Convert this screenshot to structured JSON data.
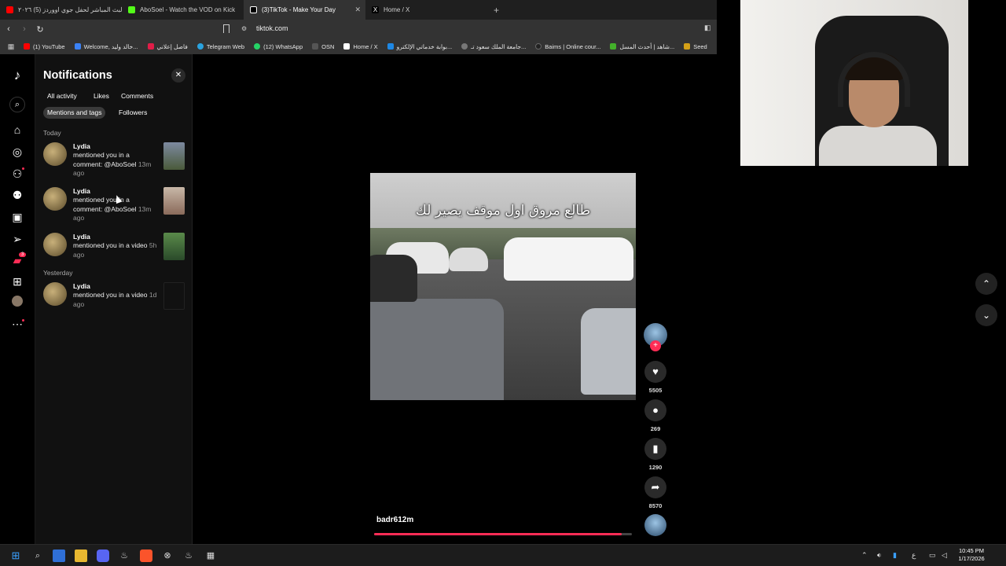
{
  "browser": {
    "tabs": [
      {
        "label": "البث المباشر لحفل جوي اووردز (5) ٢٠٢٦",
        "color": "#ff0000"
      },
      {
        "label": "AboSoel - Watch the VOD on Kick",
        "color": "#53fc18"
      },
      {
        "label": "(3)TikTok - Make Your Day",
        "color": "#ffffff"
      },
      {
        "label": "Home / X",
        "color": "#ffffff"
      }
    ],
    "url": "tiktok.com",
    "bookmarks": [
      {
        "label": "(1) YouTube",
        "color": "#ff0000"
      },
      {
        "label": "Welcome, خالد وليد...",
        "color": "#3b82f6"
      },
      {
        "label": "فاصل إعلاني",
        "color": "#e11d48"
      },
      {
        "label": "Telegram Web",
        "color": "#2aa3e0"
      },
      {
        "label": "(12) WhatsApp",
        "color": "#25d366"
      },
      {
        "label": "OSN",
        "color": "#333333"
      },
      {
        "label": "Home / X",
        "color": "#ffffff"
      },
      {
        "label": "بوابة خدماتي الإلكترو...",
        "color": "#1e88e5"
      },
      {
        "label": "جامعة الملك سعود تـ...",
        "color": "#777777"
      },
      {
        "label": "Baims | Online cour...",
        "color": "#222222"
      },
      {
        "label": "شاهد | أحدث المسل...",
        "color": "#43b02a"
      },
      {
        "label": "Seed",
        "color": "#d4a017"
      }
    ]
  },
  "sidebar": {
    "badges": {
      "inbox": "3"
    },
    "icons": [
      "tiktok-logo-icon",
      "search-icon",
      "home-icon",
      "explore-icon",
      "following-icon",
      "friends-icon",
      "live-icon",
      "messages-icon",
      "inbox-icon",
      "upload-icon",
      "profile-icon",
      "more-icon"
    ]
  },
  "notifications": {
    "title": "Notifications",
    "filters": [
      "All activity",
      "Likes",
      "Comments",
      "Mentions and tags",
      "Followers"
    ],
    "selected_filter": "Mentions and tags",
    "sections": [
      {
        "label": "Today",
        "items": [
          {
            "user": "Lydia",
            "text": "mentioned you in a comment: @AboSoel",
            "time": "13m ago"
          },
          {
            "user": "Lydia",
            "text": "mentioned you in a comment: @AboSoel",
            "time": "13m ago"
          },
          {
            "user": "Lydia",
            "text": "mentioned you in a video",
            "time": "5h ago"
          }
        ]
      },
      {
        "label": "Yesterday",
        "items": [
          {
            "user": "Lydia",
            "text": "mentioned you in a video",
            "time": "1d ago"
          }
        ]
      }
    ]
  },
  "video": {
    "caption": "طالع مروق اول موقف يصير لك",
    "author": "badr612m",
    "progress": 0.96
  },
  "actions": {
    "likes": "5505",
    "comments": "269",
    "saves": "1290",
    "shares": "8570"
  },
  "taskbar": {
    "time": "10:45 PM",
    "date": "1/17/2026",
    "lang": "ع"
  },
  "colors": {
    "accent": "#fe2c55",
    "panel": "#111111"
  }
}
